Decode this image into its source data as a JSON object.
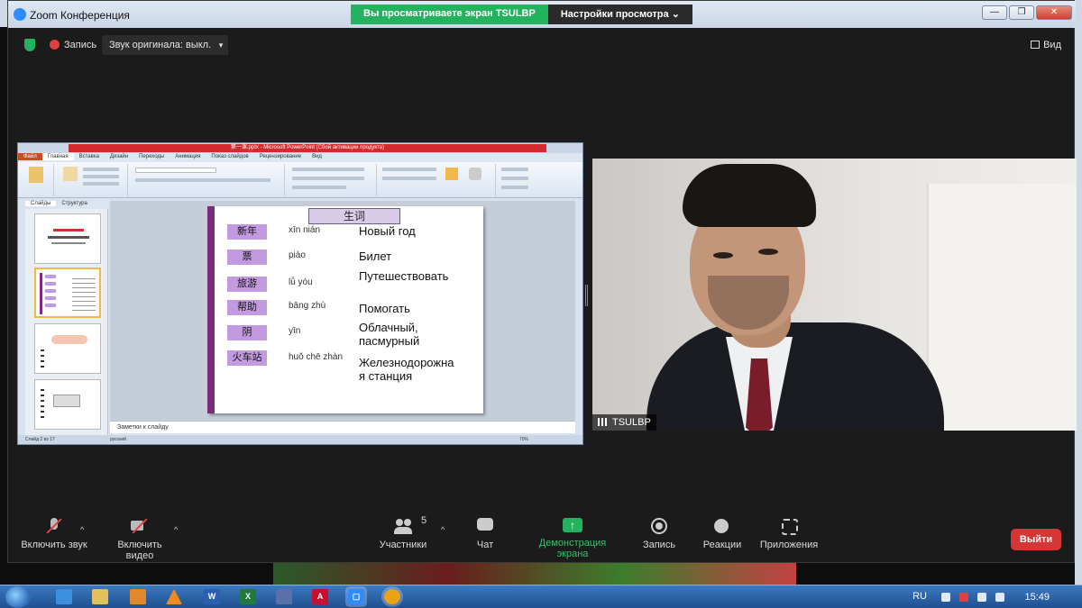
{
  "zoom": {
    "title": "Zoom Конференция",
    "share_banner": "Вы просматриваете экран TSULBP",
    "view_settings": "Настройки просмотра ⌄",
    "win_min": "—",
    "win_max": "❐",
    "win_close": "✕"
  },
  "top_toolbar": {
    "record_label": "Запись",
    "original_sound": "Звук оригинала: выкл.",
    "caret": "▾",
    "view_label": "Вид"
  },
  "ppt": {
    "window_title": "第一课.pptx - Microsoft PowerPoint (Сбой активации продукта)",
    "tabs": [
      "Файл",
      "Главная",
      "Вставка",
      "Дизайн",
      "Переходы",
      "Анимация",
      "Показ слайдов",
      "Рецензирование",
      "Вид"
    ],
    "panel_tabs": [
      "Слайды",
      "Структура"
    ],
    "notes_placeholder": "Заметки к слайду",
    "status_slide": "Слайд 2 из 17",
    "status_lang": "русский",
    "zoom_level": "70%"
  },
  "slide": {
    "title": "生词",
    "rows": [
      {
        "cn": "新年",
        "py": "xīn nián",
        "ru": "Новый год"
      },
      {
        "cn": "票",
        "py": "piào",
        "ru": "Билет"
      },
      {
        "cn": "旅游",
        "py": "lǚ yóu",
        "ru": "Путешествовать"
      },
      {
        "cn": "帮助",
        "py": "bāng zhù",
        "ru": "Помогать"
      },
      {
        "cn": "阴",
        "py": "yīn",
        "ru": "Облачный, пасмурный"
      },
      {
        "cn": "火车站",
        "py": "huǒ chē zhàn",
        "ru": "Железнодорожная станция"
      }
    ]
  },
  "video": {
    "participant_name": "TSULBP"
  },
  "bottom_toolbar": {
    "unmute": "Включить звук",
    "start_video": "Включить видео",
    "participants": "Участники",
    "participants_count": "5",
    "chat": "Чат",
    "share_screen": "Демонстрация экрана",
    "record": "Запись",
    "reactions": "Реакции",
    "apps": "Приложения",
    "leave": "Выйти",
    "caret": "^"
  },
  "taskbar": {
    "lang": "RU",
    "clock": "15:49",
    "apps": [
      "ie",
      "explorer",
      "media",
      "vlc",
      "word",
      "excel",
      "save",
      "acrobat",
      "zoom",
      "chrome"
    ],
    "colors": {
      "word": "#2b5fb4",
      "excel": "#1f7a3c",
      "acrobat": "#c8102e",
      "zoom": "#2d8cff",
      "chrome": "#e8a317"
    }
  }
}
